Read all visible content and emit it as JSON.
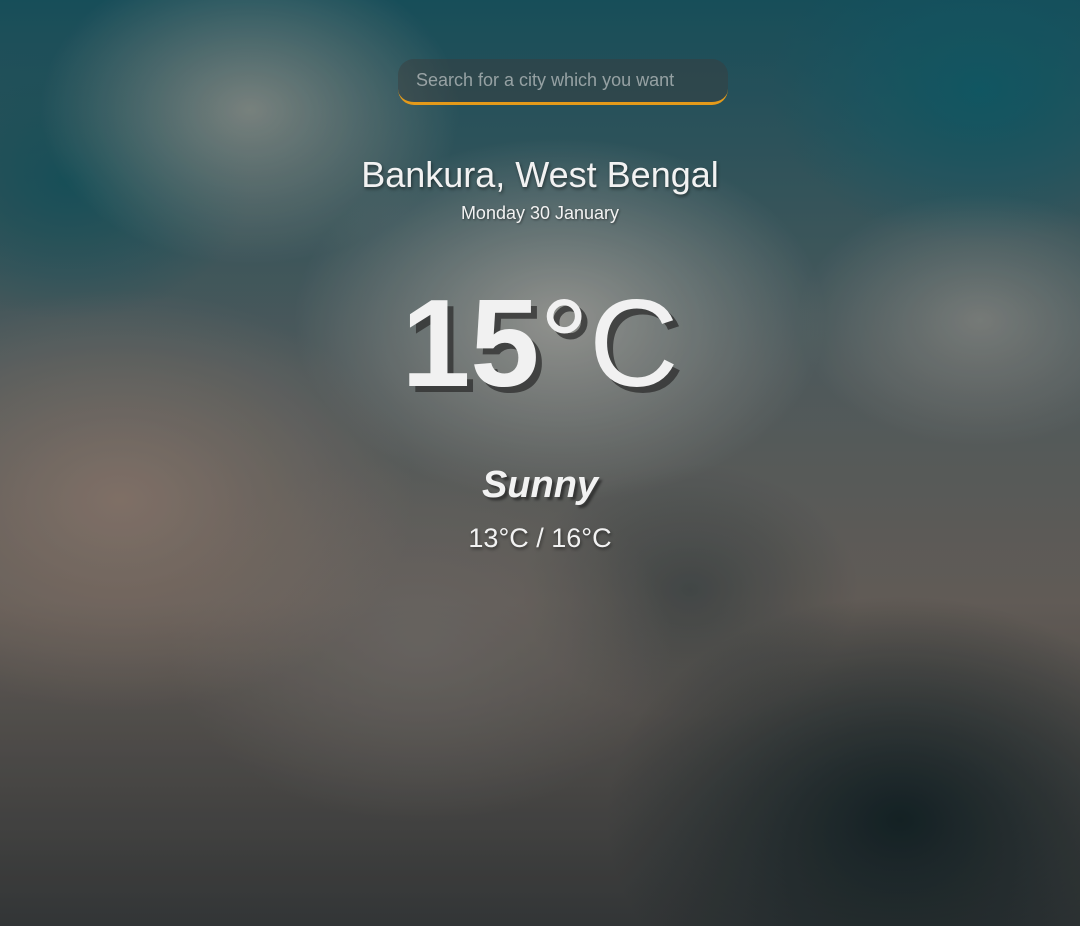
{
  "search": {
    "placeholder": "Search for a city which you want",
    "value": "",
    "accent_color": "#e49a1a"
  },
  "weather": {
    "location": "Bankura, West Bengal",
    "date": "Monday 30 January",
    "temperature": "15",
    "unit": "°C",
    "condition": "Sunny",
    "hi_low": "13°C / 16°C"
  }
}
